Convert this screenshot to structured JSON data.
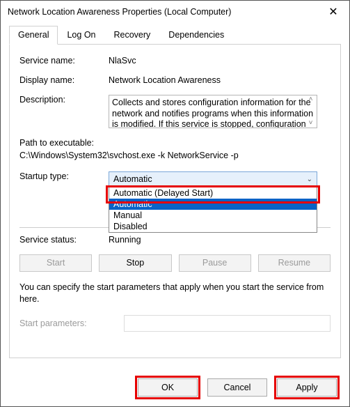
{
  "window": {
    "title": "Network Location Awareness Properties (Local Computer)"
  },
  "tabs": {
    "general": "General",
    "logon": "Log On",
    "recovery": "Recovery",
    "dependencies": "Dependencies"
  },
  "labels": {
    "service_name": "Service name:",
    "display_name": "Display name:",
    "description": "Description:",
    "path": "Path to executable:",
    "startup_type": "Startup type:",
    "service_status": "Service status:",
    "note": "You can specify the start parameters that apply when you start the service from here.",
    "start_params": "Start parameters:"
  },
  "values": {
    "service_name": "NlaSvc",
    "display_name": "Network Location Awareness",
    "description": "Collects and stores configuration information for the network and notifies programs when this information is modified. If this service is stopped, configuration",
    "path": "C:\\Windows\\System32\\svchost.exe -k NetworkService -p",
    "startup_selected": "Automatic",
    "service_status": "Running",
    "start_params": ""
  },
  "startup_options": {
    "delayed": "Automatic (Delayed Start)",
    "automatic": "Automatic",
    "manual": "Manual",
    "disabled": "Disabled"
  },
  "buttons": {
    "start": "Start",
    "stop": "Stop",
    "pause": "Pause",
    "resume": "Resume",
    "ok": "OK",
    "cancel": "Cancel",
    "apply": "Apply"
  }
}
